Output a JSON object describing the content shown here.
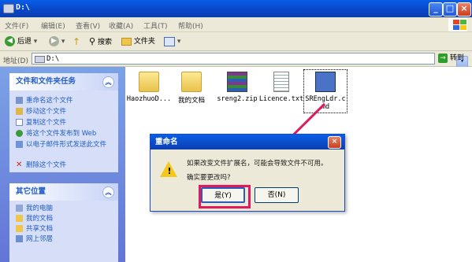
{
  "window": {
    "title": "D:\\"
  },
  "menu": {
    "items": [
      "文件(F)",
      "编辑(E)",
      "查看(V)",
      "收藏(A)",
      "工具(T)",
      "帮助(H)"
    ]
  },
  "toolbar": {
    "back_label": "后退",
    "search_label": "搜索",
    "folders_label": "文件夹"
  },
  "address": {
    "label": "地址(D)",
    "value": "D:\\",
    "go_label": "转到"
  },
  "side": {
    "tasks_title": "文件和文件夹任务",
    "tasks": [
      "重命名这个文件",
      "移动这个文件",
      "复制这个文件",
      "将这个文件发布到 Web",
      "以电子邮件形式发送此文件",
      "删除这个文件"
    ],
    "places_title": "其它位置",
    "places": [
      "我的电脑",
      "我的文档",
      "共享文档",
      "网上邻居"
    ]
  },
  "files": [
    {
      "name": "HaozhuoD...",
      "icon": "folder-icon"
    },
    {
      "name": "我的文档",
      "icon": "folder-icon"
    },
    {
      "name": "sreng2.zip",
      "icon": "archive-icon"
    },
    {
      "name": "Licence.txt",
      "icon": "text-file-icon"
    },
    {
      "name": "SREngLdr.cmd",
      "icon": "cmd-file-icon"
    }
  ],
  "dialog": {
    "title": "重命名",
    "message_line1": "如果改变文件扩展名，可能会导致文件不可用。",
    "message_line2": "确实要更改吗?",
    "yes_label": "是(Y)",
    "no_label": "否(N)"
  },
  "colors": {
    "titlebar": "#0845c8",
    "highlight": "#e11a5d"
  }
}
